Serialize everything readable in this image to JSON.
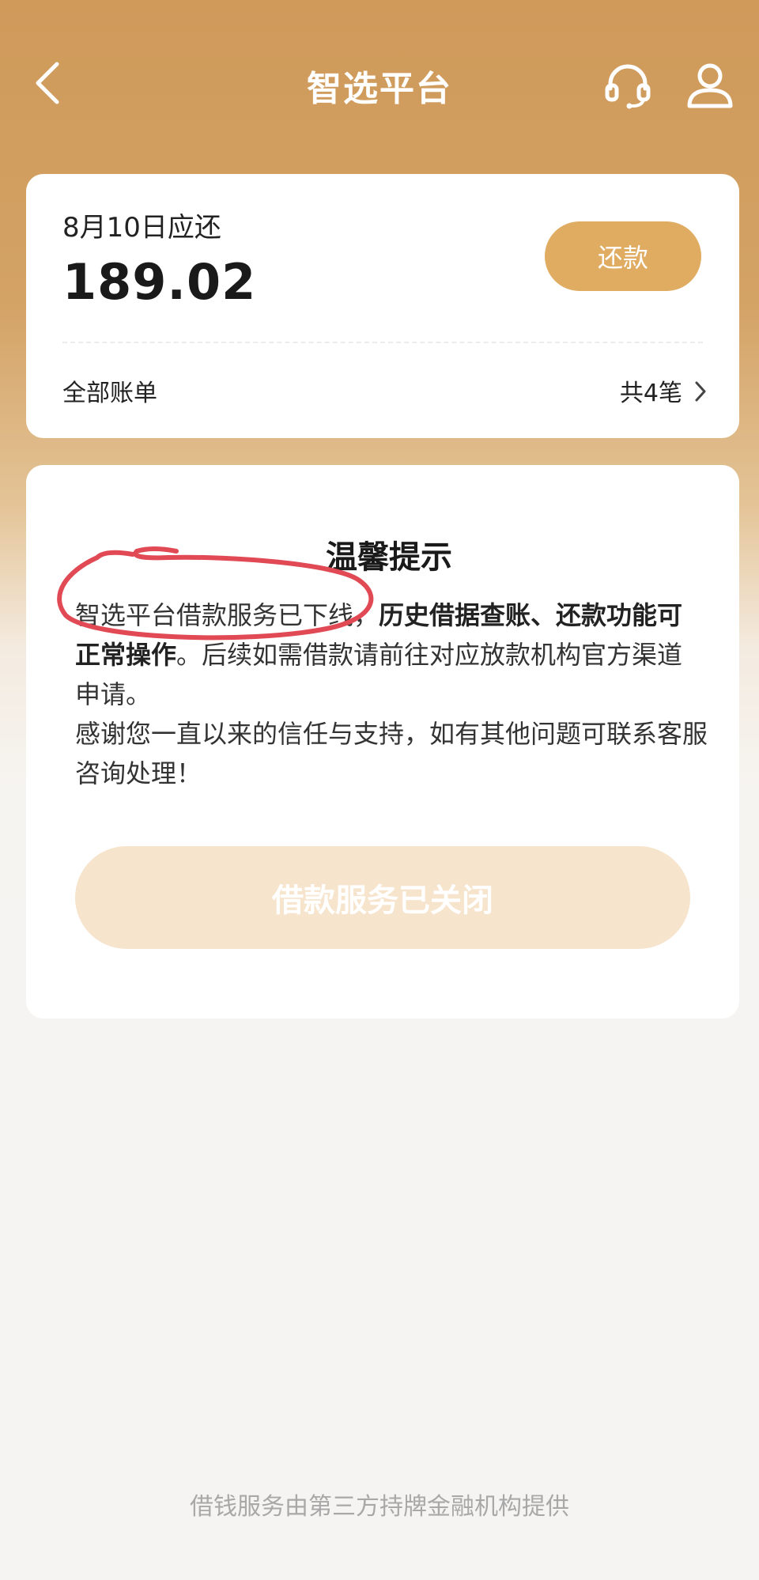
{
  "header": {
    "title": "智选平台",
    "back_icon": "chevron-left-icon",
    "service_icon": "headset-icon",
    "user_icon": "user-icon"
  },
  "bill": {
    "due_label": "8月10日应还",
    "amount": "189.02",
    "repay_label": "还款",
    "all_bills_label": "全部账单",
    "count_label": "共4笔"
  },
  "notice": {
    "title": "温馨提示",
    "line_plain": "智选平台借款服务已下线，",
    "line_bold": "历史借据查账、还款功能可正常操作",
    "line_rest": "。后续如需借款请前往对应放款机构官方渠道申请。",
    "line_thanks": "感谢您一直以来的信任与支持，如有其他问题可联系客服咨询处理！",
    "closed_button": "借款服务已关闭"
  },
  "footer": {
    "text": "借钱服务由第三方持牌金融机构提供"
  },
  "colors": {
    "brand": "#d3a265",
    "button": "#e0ac62",
    "annotation": "#e14a55"
  }
}
